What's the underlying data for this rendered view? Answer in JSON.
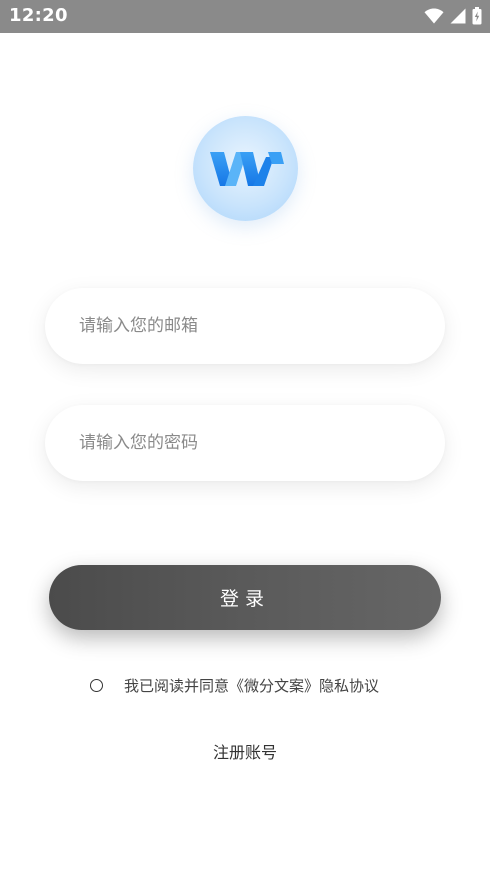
{
  "status_bar": {
    "time": "12:20",
    "icons": [
      "wifi-icon",
      "signal-icon",
      "battery-icon"
    ]
  },
  "logo": {
    "icon": "app-logo-w-icon",
    "accent": "#2b8ff0",
    "background": "#c9e4fc"
  },
  "form": {
    "email_placeholder": "请输入您的邮箱",
    "email_value": "",
    "password_placeholder": "请输入您的密码",
    "password_value": ""
  },
  "login_button": {
    "label": "登录",
    "color": "#555555"
  },
  "agreement": {
    "checked": false,
    "text": "我已阅读并同意《微分文案》隐私协议"
  },
  "register": {
    "label": "注册账号"
  }
}
